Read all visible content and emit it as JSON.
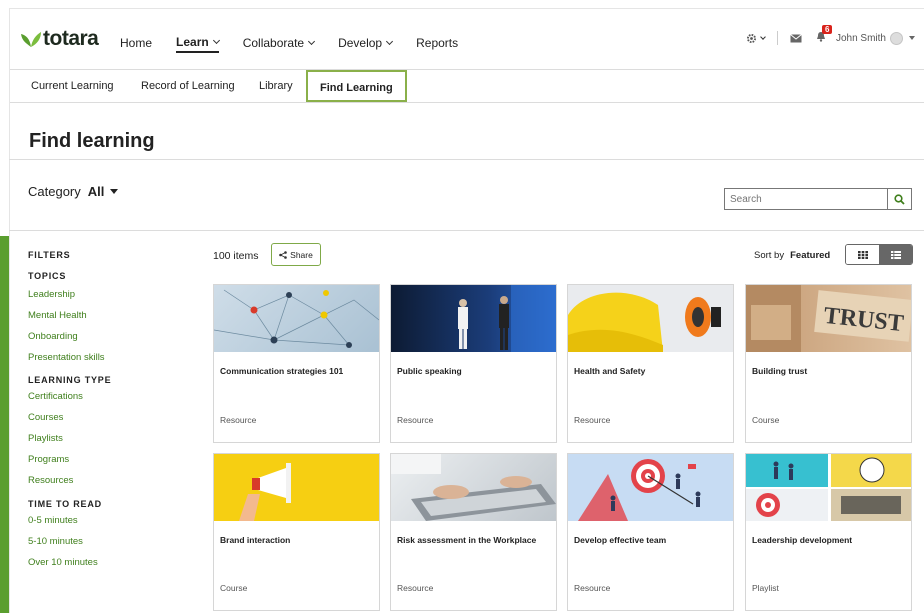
{
  "brand": {
    "name": "totara",
    "accent": "#5a9e2f"
  },
  "topnav": {
    "items": [
      {
        "label": "Home",
        "has_menu": false,
        "active": false
      },
      {
        "label": "Learn",
        "has_menu": true,
        "active": true
      },
      {
        "label": "Collaborate",
        "has_menu": true,
        "active": false
      },
      {
        "label": "Develop",
        "has_menu": true,
        "active": false
      },
      {
        "label": "Reports",
        "has_menu": false,
        "active": false
      }
    ],
    "notifications_count": "6",
    "user_name": "John Smith"
  },
  "subnav": {
    "tabs": [
      {
        "label": "Current Learning"
      },
      {
        "label": "Record of Learning"
      },
      {
        "label": "Library"
      },
      {
        "label": "Find Learning"
      }
    ],
    "active_tab": "Find Learning"
  },
  "page": {
    "title": "Find learning",
    "category_label": "Category",
    "category_value": "All",
    "search_placeholder": "Search"
  },
  "filters": {
    "heading": "FILTERS",
    "groups": [
      {
        "heading": "TOPICS",
        "items": [
          "Leadership",
          "Mental Health",
          "Onboarding",
          "Presentation skills"
        ]
      },
      {
        "heading": "LEARNING TYPE",
        "items": [
          "Certifications",
          "Courses",
          "Playlists",
          "Programs",
          "Resources"
        ]
      },
      {
        "heading": "TIME TO READ",
        "items": [
          "0-5 minutes",
          "5-10 minutes",
          "Over 10 minutes"
        ]
      }
    ]
  },
  "toolbar": {
    "count": "100 items",
    "share_label": "Share",
    "sort_label": "Sort by",
    "sort_value": "Featured"
  },
  "cards": [
    {
      "title": "Communication strategies 101",
      "type": "Resource",
      "image": "network-pins"
    },
    {
      "title": "Public speaking",
      "type": "Resource",
      "image": "presenters-stage"
    },
    {
      "title": "Health and Safety",
      "type": "Resource",
      "image": "hard-hat"
    },
    {
      "title": "Building trust",
      "type": "Course",
      "image": "trust-blocks"
    },
    {
      "title": "Brand interaction",
      "type": "Course",
      "image": "megaphone"
    },
    {
      "title": "Risk assessment in the Workplace",
      "type": "Resource",
      "image": "laptop-hands"
    },
    {
      "title": "Develop effective team",
      "type": "Resource",
      "image": "target-team"
    },
    {
      "title": "Leadership development",
      "type": "Playlist",
      "image": "collage"
    }
  ]
}
